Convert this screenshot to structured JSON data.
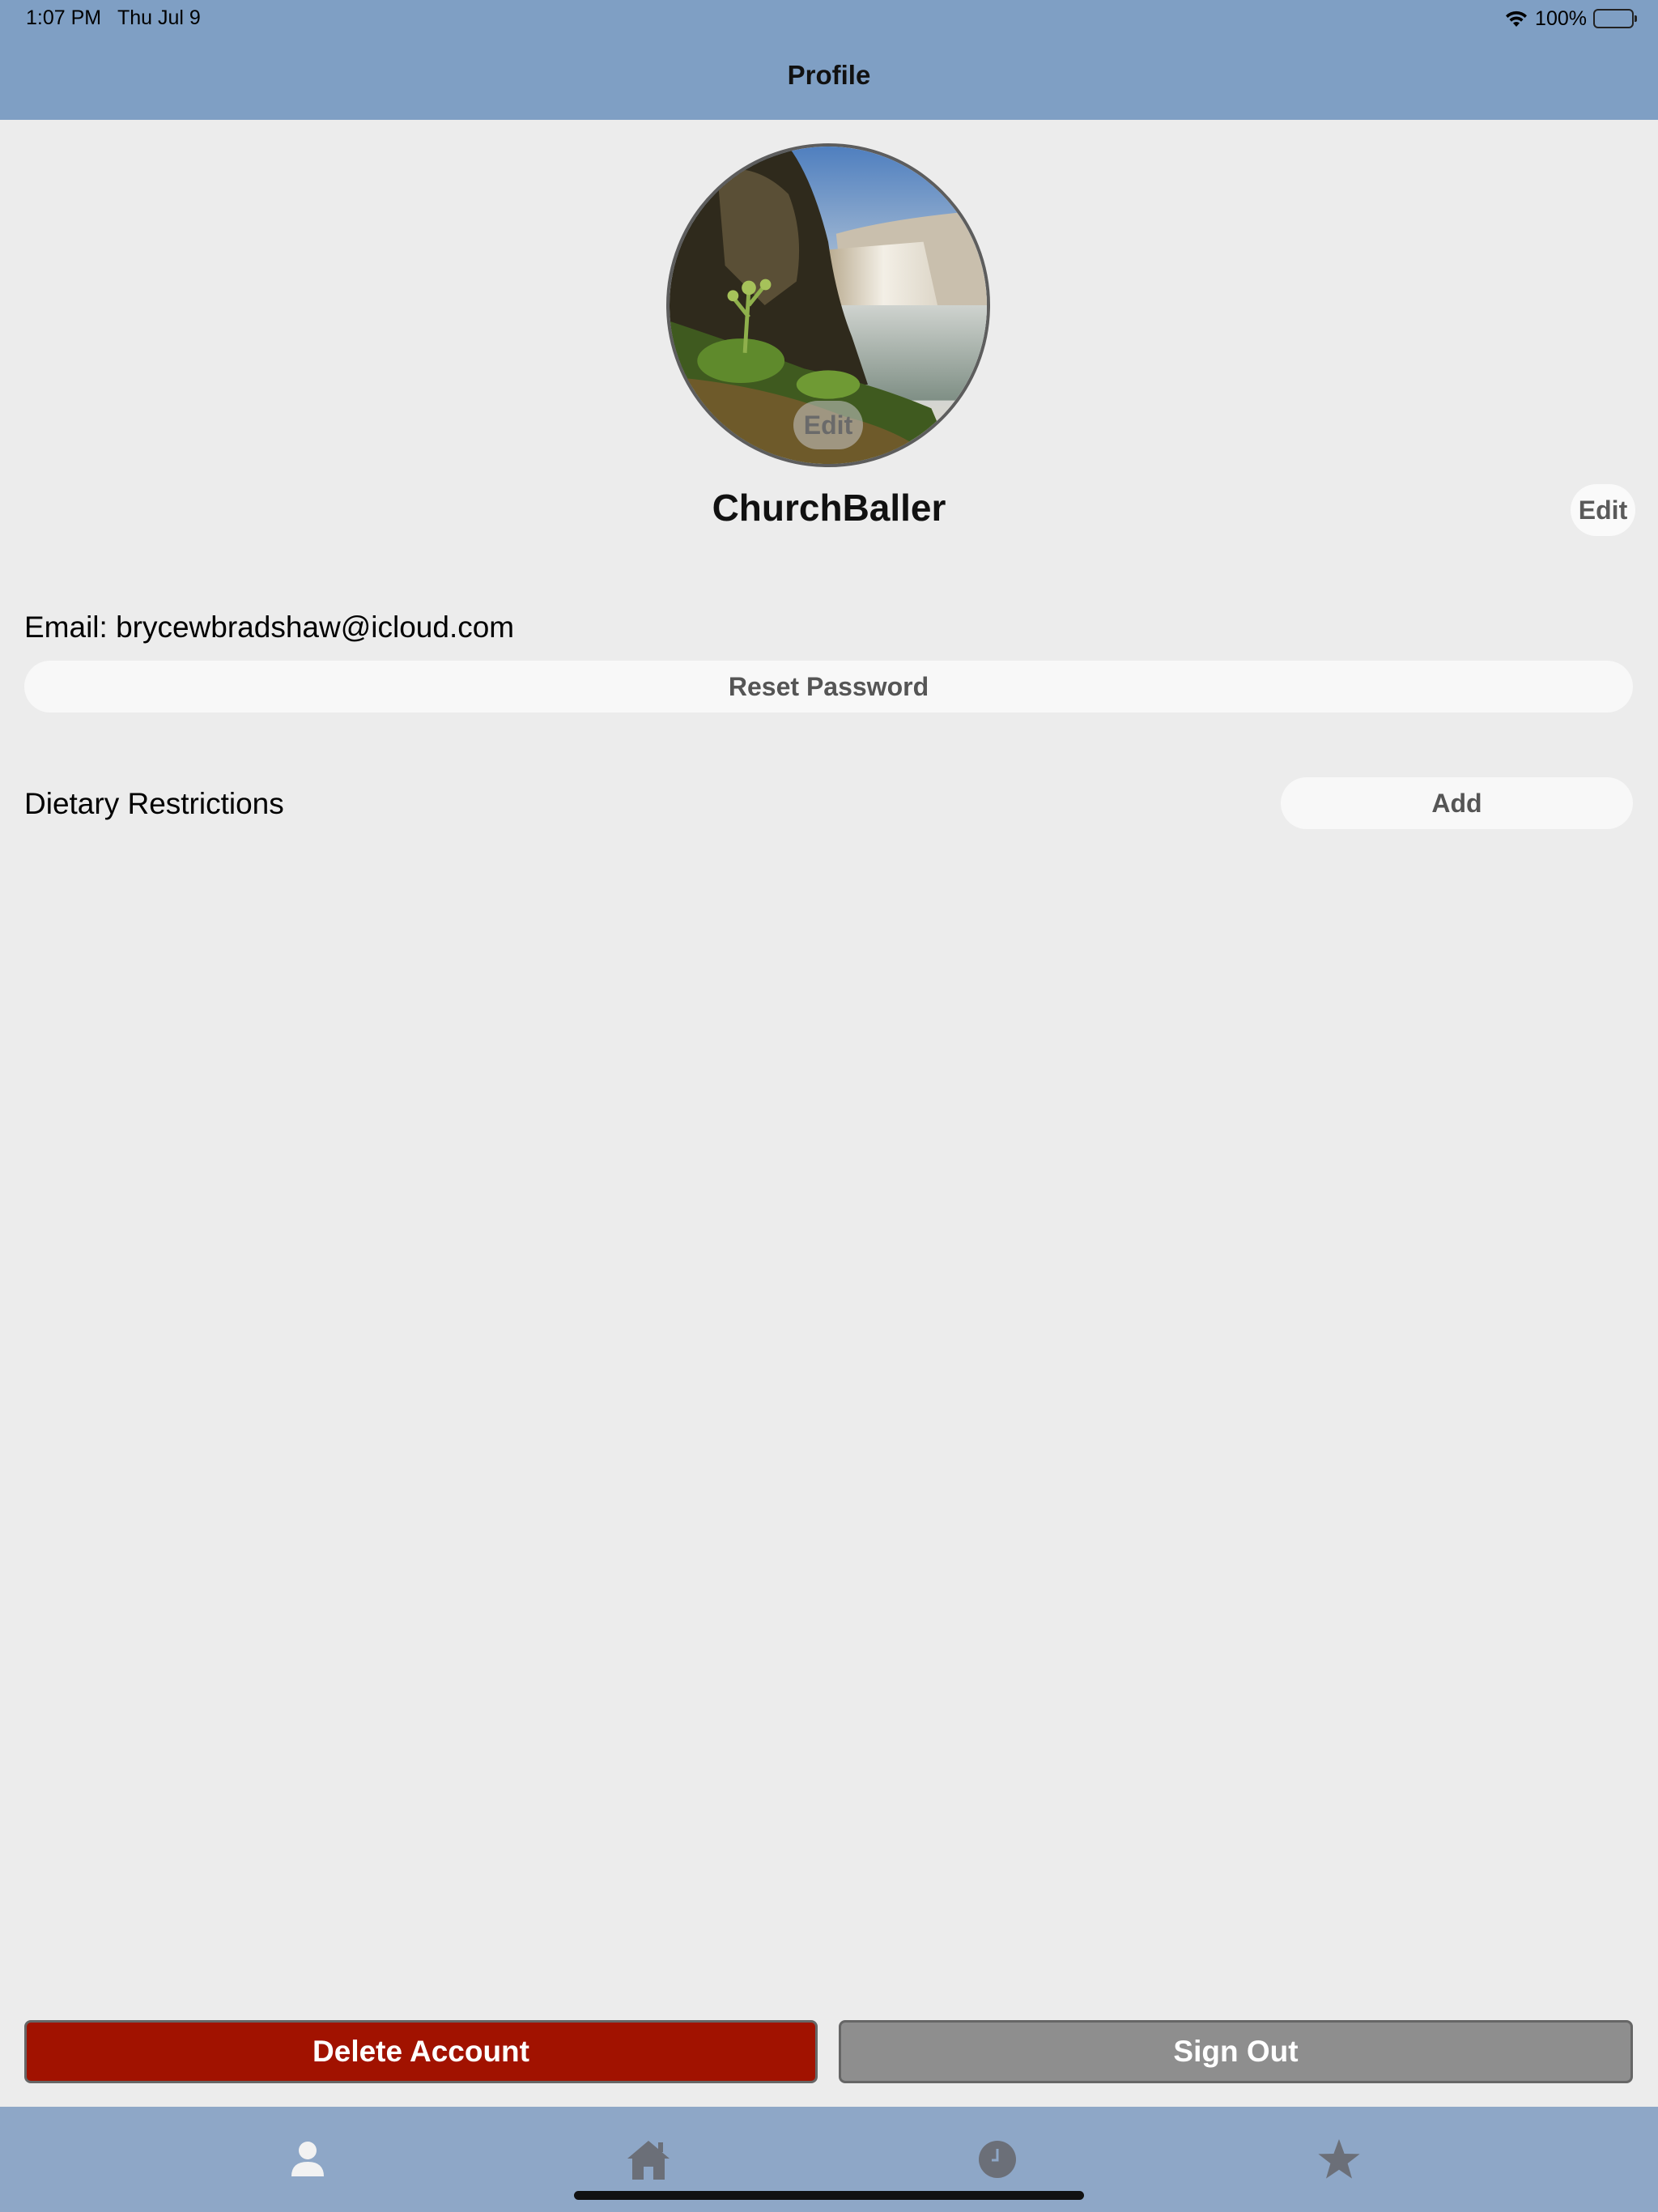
{
  "status_bar": {
    "time": "1:07 PM",
    "date": "Thu Jul 9",
    "battery": "100%"
  },
  "nav": {
    "title": "Profile"
  },
  "profile": {
    "avatar_edit_label": "Edit",
    "username": "ChurchBaller",
    "username_edit_label": "Edit",
    "email_line": "Email: brycewbradshaw@icloud.com",
    "reset_password_label": "Reset Password",
    "dietary_label": "Dietary Restrictions",
    "dietary_add_label": "Add"
  },
  "actions": {
    "delete_label": "Delete Account",
    "signout_label": "Sign Out"
  },
  "tabs": [
    {
      "icon": "person-icon",
      "selected": true
    },
    {
      "icon": "home-icon",
      "selected": false
    },
    {
      "icon": "clock-icon",
      "selected": false
    },
    {
      "icon": "star-icon",
      "selected": false
    }
  ],
  "colors": {
    "header_bg": "#7f9fc4",
    "tabbar_bg": "#8ea7c7",
    "page_bg": "#ececec",
    "delete_bg": "#a11200",
    "signout_bg": "#8e8e8e"
  }
}
